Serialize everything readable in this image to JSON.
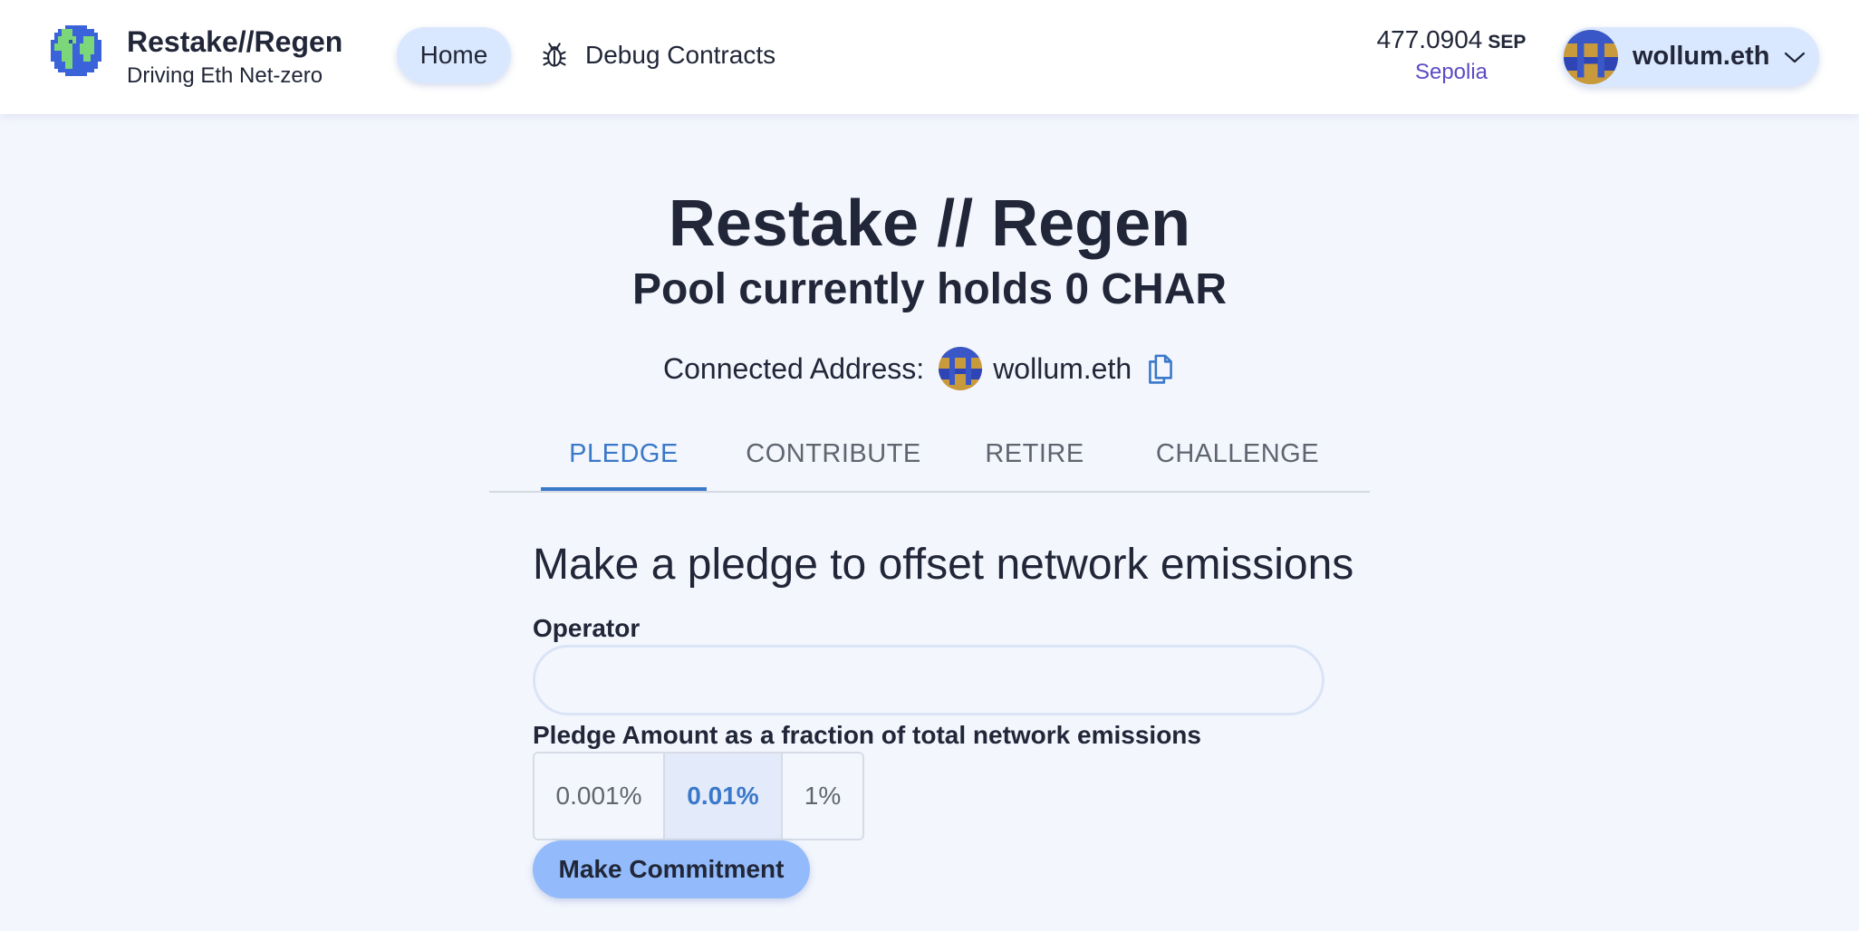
{
  "header": {
    "brand_title": "Restake//Regen",
    "brand_subtitle": "Driving Eth Net-zero",
    "nav": {
      "home": "Home",
      "debug": "Debug Contracts"
    },
    "balance": {
      "amount": "477.0904",
      "unit": "SEP"
    },
    "network": "Sepolia",
    "wallet_name": "wollum.eth"
  },
  "main": {
    "title": "Restake // Regen",
    "subtitle": "Pool currently holds 0 CHAR",
    "connected_label": "Connected Address:",
    "connected_address": "wollum.eth",
    "tabs": [
      "PLEDGE",
      "CONTRIBUTE",
      "RETIRE",
      "CHALLENGE"
    ],
    "active_tab": "PLEDGE",
    "form": {
      "section_title": "Make a pledge to offset network emissions",
      "operator_label": "Operator",
      "operator_value": "",
      "operator_placeholder": "",
      "amount_label": "Pledge Amount as a fraction of total network emissions",
      "amount_options": [
        "0.001%",
        "0.01%",
        "1%"
      ],
      "selected_amount": "0.01%",
      "submit_label": "Make Commitment"
    }
  },
  "colors": {
    "accent": "#3a78c9",
    "button_primary": "#93bbfb",
    "pill_bg": "#dae8ff",
    "network_text": "#5b4bc4",
    "page_bg": "#f3f6fd"
  },
  "icons": [
    "globe-logo-icon",
    "bug-icon",
    "wallet-avatar-icon",
    "chevron-down-icon",
    "copy-icon"
  ]
}
